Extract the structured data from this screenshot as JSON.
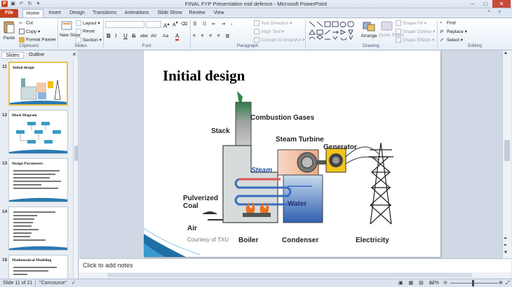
{
  "app": {
    "window_title": "FINAL FYP Presentation mid defence - Microsoft PowerPoint",
    "app_icon": "P",
    "window_controls": [
      "minimize",
      "maximize",
      "close"
    ]
  },
  "tabs": [
    "File",
    "Home",
    "Insert",
    "Design",
    "Transitions",
    "Animations",
    "Slide Show",
    "Review",
    "View"
  ],
  "ribbon": {
    "clipboard": {
      "paste": "Paste",
      "cut": "Cut",
      "copy": "Copy",
      "format_painter": "Format Painter",
      "label": "Clipboard"
    },
    "slides": {
      "new_slide": "New Slide",
      "layout": "Layout",
      "reset": "Reset",
      "section": "Section",
      "label": "Slides"
    },
    "font": {
      "bold": "B",
      "italic": "I",
      "underline": "U",
      "strike": "S",
      "shadow": "abe",
      "spacing": "AV",
      "case": "Aa",
      "color": "A",
      "label": "Font"
    },
    "paragraph": {
      "text_direction": "Text Direction",
      "align_text": "Align Text",
      "convert": "Convert to SmartArt",
      "label": "Paragraph"
    },
    "drawing": {
      "arrange": "Arrange",
      "quick_styles": "Quick Styles",
      "shape_fill": "Shape Fill",
      "shape_outline": "Shape Outline",
      "shape_effects": "Shape Effects",
      "label": "Drawing"
    },
    "editing": {
      "find": "Find",
      "replace": "Replace",
      "select": "Select",
      "label": "Editing"
    }
  },
  "panes": {
    "slides_tab": "Slides",
    "outline_tab": "Outline"
  },
  "thumbnails": [
    {
      "number": "11",
      "title": "Initial design"
    },
    {
      "number": "12",
      "title": "Block Diagram"
    },
    {
      "number": "13",
      "title": "Design Parameters"
    },
    {
      "number": "14",
      "title": ""
    },
    {
      "number": "15",
      "title": "Mathematical Modeling"
    }
  ],
  "slide": {
    "title": "Initial design",
    "diagram_labels": {
      "combustion_gases": "Combustion Gases",
      "stack": "Stack",
      "steam_turbine": "Steam Turbine",
      "generator": "Generator",
      "steam": "Steam",
      "pulverized_coal": "Pulverized Coal",
      "water": "Water",
      "air": "Air",
      "courtesy": "Courtesy of TXU",
      "boiler": "Boiler",
      "condenser": "Condenser",
      "electricity": "Electricity"
    }
  },
  "notes": {
    "placeholder": "Click to add notes"
  },
  "status": {
    "slide_info": "Slide 11 of 21",
    "theme": "\"Concourse\"",
    "zoom": "82%"
  },
  "colors": {
    "file_tab": "#c8411e",
    "selection": "#f1c04a",
    "ribbon_bg": "#e7eef7"
  }
}
